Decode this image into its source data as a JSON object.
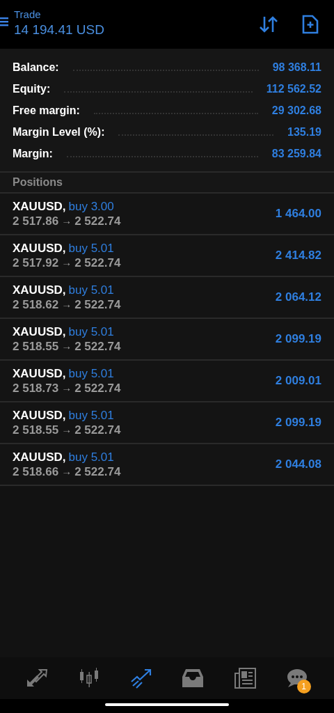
{
  "header": {
    "title": "Trade",
    "subtitle": "14 194.41 USD"
  },
  "summary": [
    {
      "label": "Balance:",
      "value": "98 368.11"
    },
    {
      "label": "Equity:",
      "value": "112 562.52"
    },
    {
      "label": "Free margin:",
      "value": "29 302.68"
    },
    {
      "label": "Margin Level (%):",
      "value": "135.19"
    },
    {
      "label": "Margin:",
      "value": "83 259.84"
    }
  ],
  "positions": {
    "heading": "Positions",
    "rows": [
      {
        "symbol": "XAUUSD,",
        "side": "buy 3.00",
        "open": "2 517.86",
        "arrow": "→",
        "current": "2 522.74",
        "profit": "1 464.00"
      },
      {
        "symbol": "XAUUSD,",
        "side": "buy 5.01",
        "open": "2 517.92",
        "arrow": "→",
        "current": "2 522.74",
        "profit": "2 414.82"
      },
      {
        "symbol": "XAUUSD,",
        "side": "buy 5.01",
        "open": "2 518.62",
        "arrow": "→",
        "current": "2 522.74",
        "profit": "2 064.12"
      },
      {
        "symbol": "XAUUSD,",
        "side": "buy 5.01",
        "open": "2 518.55",
        "arrow": "→",
        "current": "2 522.74",
        "profit": "2 099.19"
      },
      {
        "symbol": "XAUUSD,",
        "side": "buy 5.01",
        "open": "2 518.73",
        "arrow": "→",
        "current": "2 522.74",
        "profit": "2 009.01"
      },
      {
        "symbol": "XAUUSD,",
        "side": "buy 5.01",
        "open": "2 518.55",
        "arrow": "→",
        "current": "2 522.74",
        "profit": "2 099.19"
      },
      {
        "symbol": "XAUUSD,",
        "side": "buy 5.01",
        "open": "2 518.66",
        "arrow": "→",
        "current": "2 522.74",
        "profit": "2 044.08"
      }
    ]
  },
  "nav": [
    {
      "kind": "quotes",
      "selected": false
    },
    {
      "kind": "chart",
      "selected": false
    },
    {
      "kind": "trade",
      "selected": true
    },
    {
      "kind": "history",
      "selected": false
    },
    {
      "kind": "news",
      "selected": false
    },
    {
      "kind": "chat",
      "selected": false,
      "badge": "1"
    }
  ]
}
